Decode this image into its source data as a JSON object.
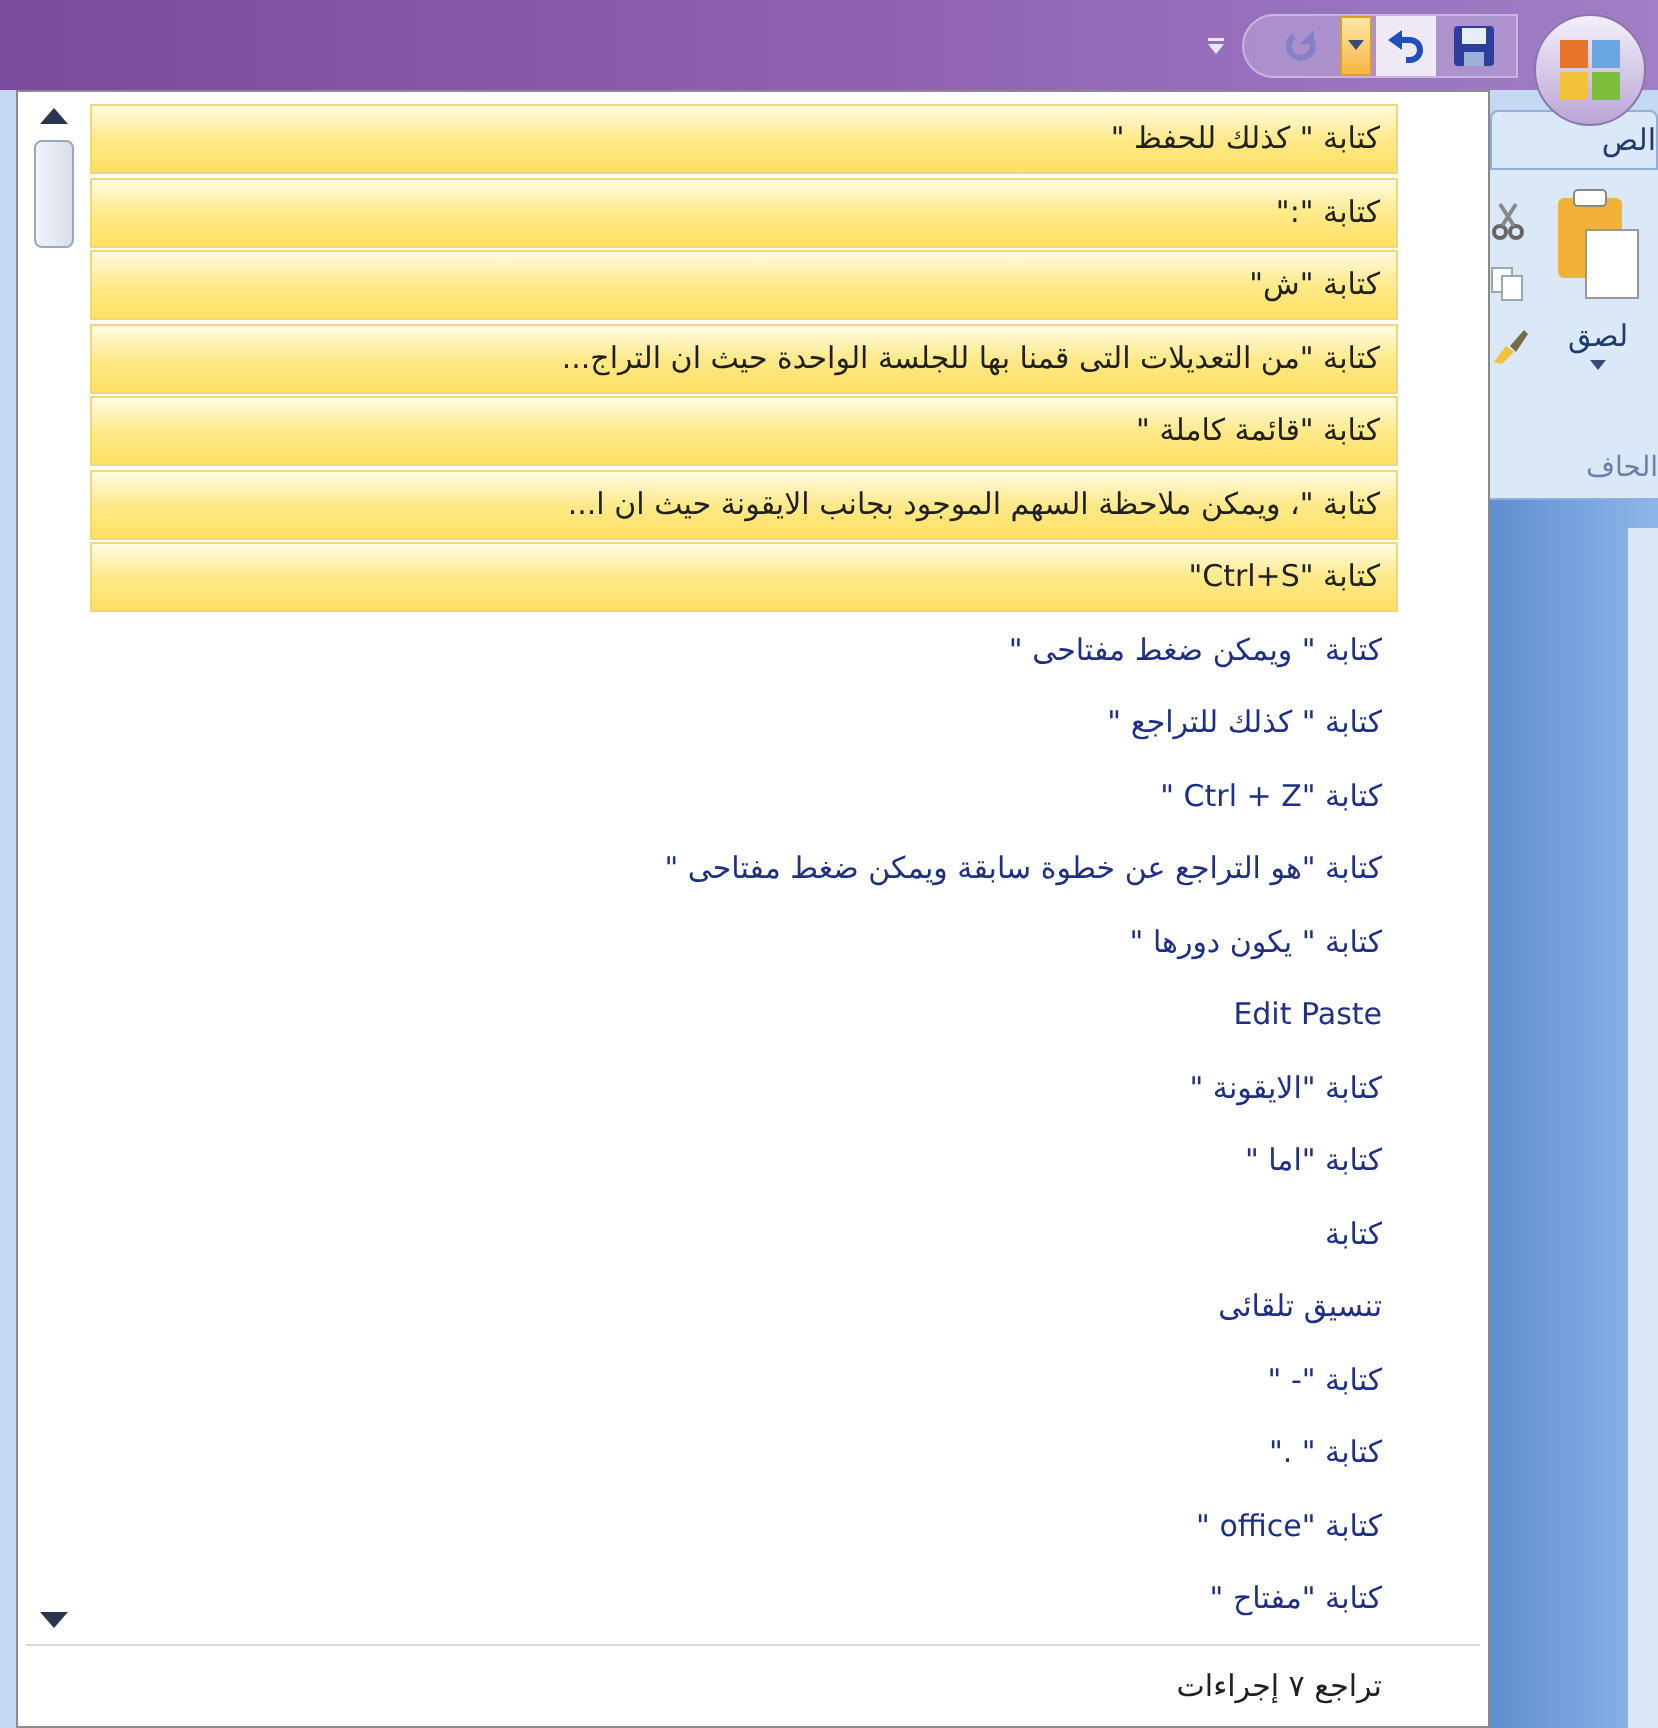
{
  "quick_access": {
    "buttons": [
      {
        "kind": "customize",
        "disabled": false,
        "selected": false
      },
      {
        "kind": "redo",
        "disabled": true,
        "selected": false
      },
      {
        "kind": "dropdown",
        "disabled": false,
        "selected": true
      },
      {
        "kind": "undo",
        "disabled": false,
        "selected": false
      },
      {
        "kind": "save",
        "disabled": false,
        "selected": false
      }
    ]
  },
  "undo_menu": {
    "items": [
      {
        "label": "كتابة \" كذلك للحفظ \"",
        "selected": true
      },
      {
        "label": "كتابة \":\"",
        "selected": true
      },
      {
        "label": "كتابة \"ش\"",
        "selected": true
      },
      {
        "label": "كتابة \"من التعديلات التى قمنا بها للجلسة الواحدة حيث ان التراج...",
        "selected": true
      },
      {
        "label": "كتابة \"قائمة كاملة \"",
        "selected": true
      },
      {
        "label": "كتابة \"، ويمكن ملاحظة السهم الموجود بجانب الايقونة حيث ان ا...",
        "selected": true
      },
      {
        "label": "كتابة \"Ctrl+S\"",
        "selected": true
      },
      {
        "label": "كتابة \" ويمكن ضغط مفتاحى \"",
        "selected": false
      },
      {
        "label": "كتابة \" كذلك للتراجع \"",
        "selected": false
      },
      {
        "label": "كتابة \"Ctrl + Z \"",
        "selected": false
      },
      {
        "label": "كتابة \"هو التراجع عن خطوة سابقة ويمكن ضغط مفتاحى \"",
        "selected": false
      },
      {
        "label": "كتابة \" يكون دورها \"",
        "selected": false
      },
      {
        "label": "Edit Paste",
        "selected": false
      },
      {
        "label": "كتابة \"الايقونة \"",
        "selected": false
      },
      {
        "label": "كتابة \"اما \"",
        "selected": false
      },
      {
        "label": "كتابة",
        "selected": false
      },
      {
        "label": "تنسيق تلقائى",
        "selected": false
      },
      {
        "label": "كتابة \"- \"",
        "selected": false
      },
      {
        "label": "كتابة \" .\"",
        "selected": false
      },
      {
        "label": "كتابة \"office \"",
        "selected": false
      },
      {
        "label": "كتابة \"مفتاح \"",
        "selected": false
      }
    ],
    "footer": "تراجع ٧ إجراءات"
  },
  "ribbon": {
    "tab": "الص",
    "paste_label": "لصق",
    "group_label": "الحاف"
  }
}
